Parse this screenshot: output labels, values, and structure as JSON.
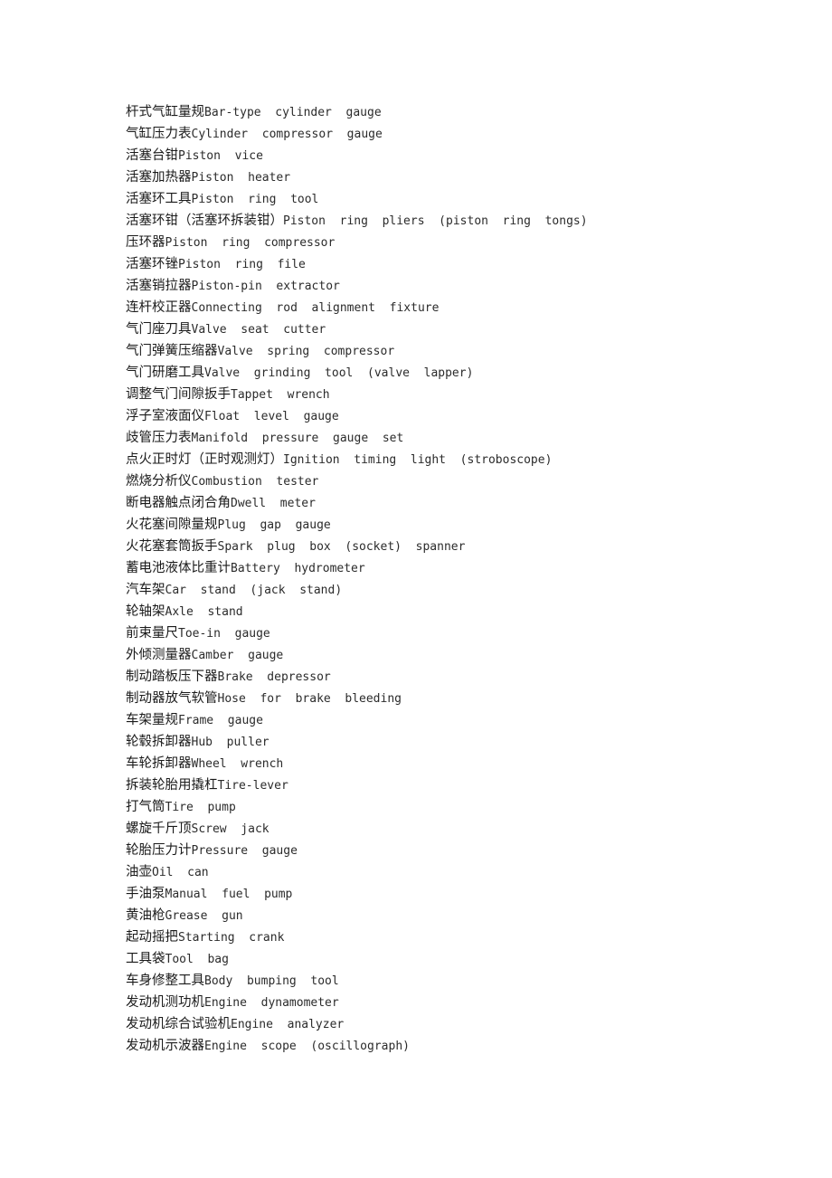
{
  "document": {
    "background_color": "#ffffff",
    "text_color": "#1a1a1a",
    "lines": [
      {
        "zh": "杆式气缸量规",
        "en": "Bar-type  cylinder  gauge"
      },
      {
        "zh": "气缸压力表",
        "en": "Cylinder  compressor  gauge"
      },
      {
        "zh": "活塞台钳",
        "en": "Piston  vice"
      },
      {
        "zh": "活塞加热器",
        "en": "Piston  heater"
      },
      {
        "zh": "活塞环工具",
        "en": "Piston  ring  tool"
      },
      {
        "zh": "活塞环钳（活塞环拆装钳）",
        "en": "Piston  ring  pliers  (piston  ring  tongs)"
      },
      {
        "zh": "压环器",
        "en": "Piston  ring  compressor"
      },
      {
        "zh": "活塞环锉",
        "en": "Piston  ring  file"
      },
      {
        "zh": "活塞销拉器",
        "en": "Piston-pin  extractor"
      },
      {
        "zh": "连杆校正器",
        "en": "Connecting  rod  alignment  fixture"
      },
      {
        "zh": "气门座刀具",
        "en": "Valve  seat  cutter"
      },
      {
        "zh": "气门弹簧压缩器",
        "en": "Valve  spring  compressor"
      },
      {
        "zh": "气门研磨工具",
        "en": "Valve  grinding  tool  (valve  lapper)"
      },
      {
        "zh": "调整气门间隙扳手",
        "en": "Tappet  wrench"
      },
      {
        "zh": "浮子室液面仪",
        "en": "Float  level  gauge"
      },
      {
        "zh": "歧管压力表",
        "en": "Manifold  pressure  gauge  set"
      },
      {
        "zh": "点火正时灯（正时观测灯）",
        "en": "Ignition  timing  light  (stroboscope)"
      },
      {
        "zh": "燃烧分析仪",
        "en": "Combustion  tester"
      },
      {
        "zh": "断电器触点闭合角",
        "en": "Dwell  meter"
      },
      {
        "zh": "火花塞间隙量规",
        "en": "Plug  gap  gauge"
      },
      {
        "zh": "火花塞套筒扳手",
        "en": "Spark  plug  box  (socket)  spanner"
      },
      {
        "zh": "蓄电池液体比重计",
        "en": "Battery  hydrometer"
      },
      {
        "zh": "汽车架",
        "en": "Car  stand  (jack  stand)"
      },
      {
        "zh": "轮轴架",
        "en": "Axle  stand"
      },
      {
        "zh": "前束量尺",
        "en": "Toe-in  gauge"
      },
      {
        "zh": "外倾测量器",
        "en": "Camber  gauge"
      },
      {
        "zh": "制动踏板压下器",
        "en": "Brake  depressor"
      },
      {
        "zh": "制动器放气软管",
        "en": "Hose  for  brake  bleeding"
      },
      {
        "zh": "车架量规",
        "en": "Frame  gauge"
      },
      {
        "zh": "轮毂拆卸器",
        "en": "Hub  puller"
      },
      {
        "zh": "车轮拆卸器",
        "en": "Wheel  wrench"
      },
      {
        "zh": "拆装轮胎用撬杠",
        "en": "Tire-lever"
      },
      {
        "zh": "打气筒",
        "en": "Tire  pump"
      },
      {
        "zh": "螺旋千斤顶",
        "en": "Screw  jack"
      },
      {
        "zh": "轮胎压力计",
        "en": "Pressure  gauge"
      },
      {
        "zh": "油壶",
        "en": "Oil  can"
      },
      {
        "zh": "手油泵",
        "en": "Manual  fuel  pump"
      },
      {
        "zh": "黄油枪",
        "en": "Grease  gun"
      },
      {
        "zh": "起动摇把",
        "en": "Starting  crank"
      },
      {
        "zh": "工具袋",
        "en": "Tool  bag"
      },
      {
        "zh": "车身修整工具",
        "en": "Body  bumping  tool"
      },
      {
        "zh": "发动机测功机",
        "en": "Engine  dynamometer"
      },
      {
        "zh": "发动机综合试验机",
        "en": "Engine  analyzer"
      },
      {
        "zh": "发动机示波器",
        "en": "Engine  scope  (oscillograph)"
      }
    ]
  }
}
